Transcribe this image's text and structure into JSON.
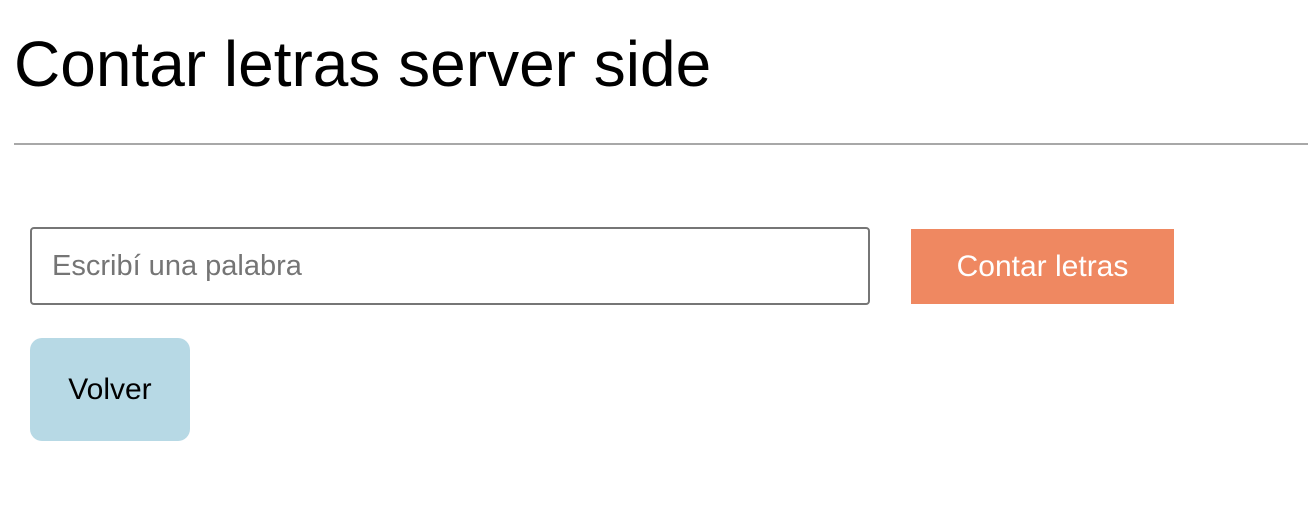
{
  "page": {
    "title": "Contar letras server side"
  },
  "form": {
    "word_input": {
      "placeholder": "Escribí una palabra",
      "value": ""
    },
    "count_button_label": "Contar letras",
    "back_button_label": "Volver"
  },
  "colors": {
    "count_button_bg": "#ef8861",
    "count_button_text": "#ffffff",
    "back_button_bg": "#b7d9e5",
    "divider": "#a8a8a8",
    "input_border": "#767676"
  }
}
